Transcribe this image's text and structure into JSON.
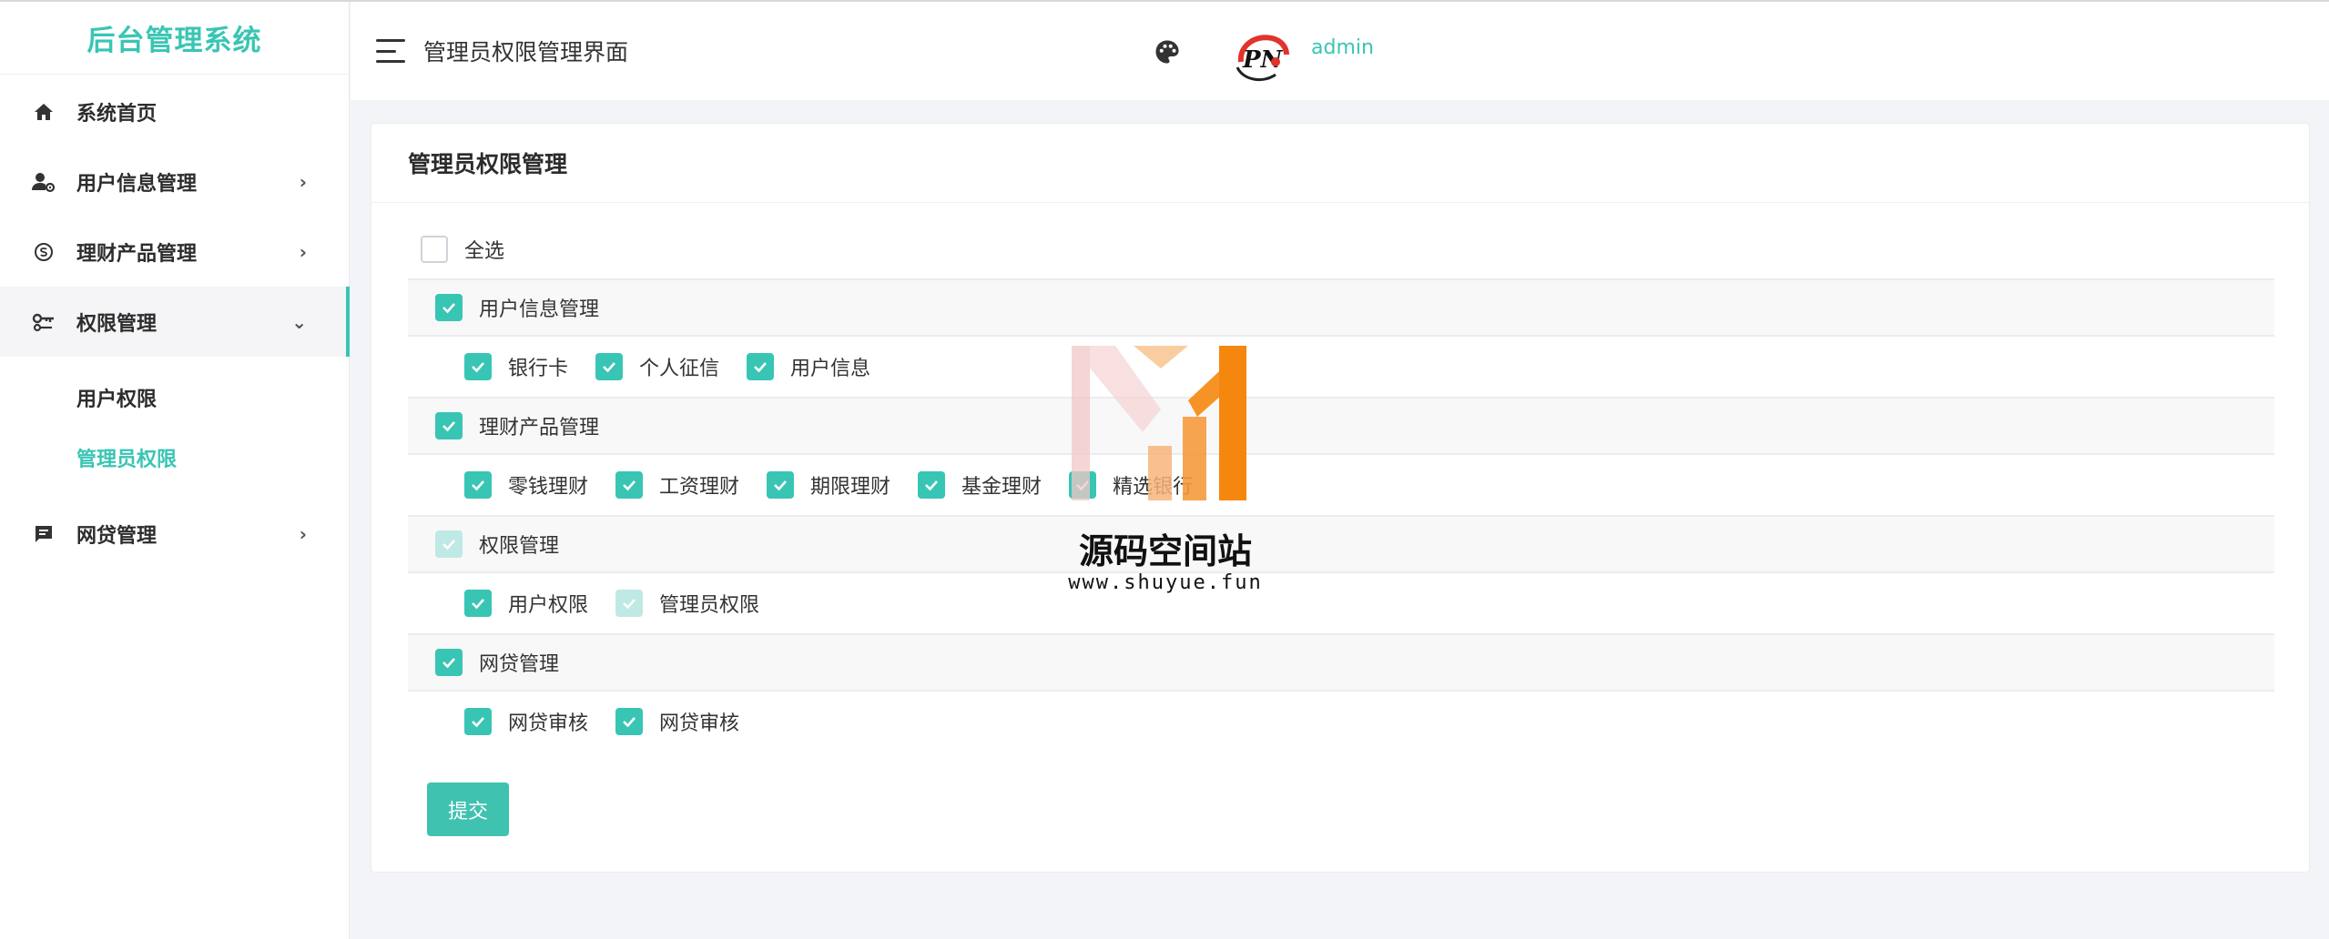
{
  "app": {
    "title": "后台管理系统",
    "accent": "#39c5b4"
  },
  "sidebar": {
    "items": [
      {
        "label": "系统首页",
        "icon": "home-icon"
      },
      {
        "label": "用户信息管理",
        "icon": "user-gear-icon"
      },
      {
        "label": "理财产品管理",
        "icon": "finance-icon"
      },
      {
        "label": "权限管理",
        "icon": "key-icon"
      },
      {
        "label": "网贷管理",
        "icon": "message-icon"
      }
    ],
    "submenu": [
      "用户权限",
      "管理员权限"
    ]
  },
  "header": {
    "title": "管理员权限管理界面",
    "username": "admin"
  },
  "card": {
    "title": "管理员权限管理",
    "select_all": "全选",
    "groups": [
      {
        "label": "用户信息管理",
        "state": "checked",
        "children": [
          {
            "label": "银行卡",
            "checked": true
          },
          {
            "label": "个人征信",
            "checked": true
          },
          {
            "label": "用户信息",
            "checked": true
          }
        ]
      },
      {
        "label": "理财产品管理",
        "state": "checked",
        "children": [
          {
            "label": "零钱理财",
            "checked": true
          },
          {
            "label": "工资理财",
            "checked": true
          },
          {
            "label": "期限理财",
            "checked": true
          },
          {
            "label": "基金理财",
            "checked": true
          },
          {
            "label": "精选银行",
            "checked": true
          }
        ]
      },
      {
        "label": "权限管理",
        "state": "partial",
        "children": [
          {
            "label": "用户权限",
            "checked": true
          },
          {
            "label": "管理员权限",
            "checked": false
          }
        ]
      },
      {
        "label": "网贷管理",
        "state": "checked",
        "children": [
          {
            "label": "网贷审核",
            "checked": true
          },
          {
            "label": "网贷审核",
            "checked": true
          }
        ]
      }
    ],
    "submit": "提交"
  },
  "watermark": {
    "name": "源码空间站",
    "url": "www.shuyue.fun"
  }
}
